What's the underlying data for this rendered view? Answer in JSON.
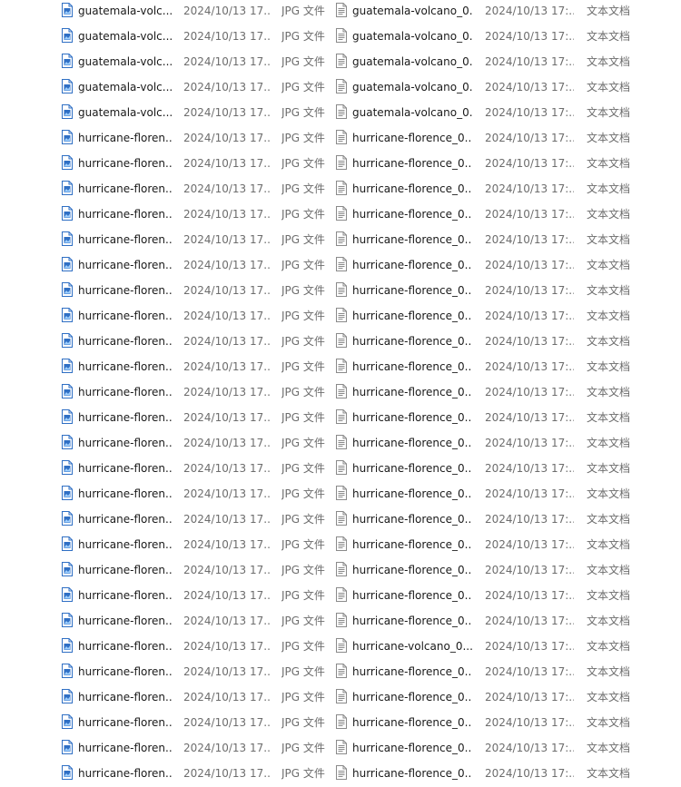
{
  "icons": {
    "image_file": "jpg-image-file-icon",
    "text_file": "text-document-icon"
  },
  "colors": {
    "jpg_icon_blue": "#2f6fc4",
    "text_icon_gray": "#8a8a8a",
    "meta_text": "#6d6d6d"
  },
  "rows": [
    {
      "left": {
        "name": "guatemala-volc...",
        "date": "2024/10/13 17...",
        "type": "JPG 文件"
      },
      "right": {
        "name": "guatemala-volcano_0...",
        "date": "2024/10/13 17:...",
        "type": "文本文档"
      }
    },
    {
      "left": {
        "name": "guatemala-volc...",
        "date": "2024/10/13 17...",
        "type": "JPG 文件"
      },
      "right": {
        "name": "guatemala-volcano_0...",
        "date": "2024/10/13 17:...",
        "type": "文本文档"
      }
    },
    {
      "left": {
        "name": "guatemala-volc...",
        "date": "2024/10/13 17...",
        "type": "JPG 文件"
      },
      "right": {
        "name": "guatemala-volcano_0...",
        "date": "2024/10/13 17:...",
        "type": "文本文档"
      }
    },
    {
      "left": {
        "name": "guatemala-volc...",
        "date": "2024/10/13 17...",
        "type": "JPG 文件"
      },
      "right": {
        "name": "guatemala-volcano_0...",
        "date": "2024/10/13 17:...",
        "type": "文本文档"
      }
    },
    {
      "left": {
        "name": "guatemala-volc...",
        "date": "2024/10/13 17...",
        "type": "JPG 文件"
      },
      "right": {
        "name": "guatemala-volcano_0...",
        "date": "2024/10/13 17:...",
        "type": "文本文档"
      }
    },
    {
      "left": {
        "name": "hurricane-floren...",
        "date": "2024/10/13 17...",
        "type": "JPG 文件"
      },
      "right": {
        "name": "hurricane-florence_0...",
        "date": "2024/10/13 17:...",
        "type": "文本文档"
      }
    },
    {
      "left": {
        "name": "hurricane-floren...",
        "date": "2024/10/13 17...",
        "type": "JPG 文件"
      },
      "right": {
        "name": "hurricane-florence_0...",
        "date": "2024/10/13 17:...",
        "type": "文本文档"
      }
    },
    {
      "left": {
        "name": "hurricane-floren...",
        "date": "2024/10/13 17...",
        "type": "JPG 文件"
      },
      "right": {
        "name": "hurricane-florence_0...",
        "date": "2024/10/13 17:...",
        "type": "文本文档"
      }
    },
    {
      "left": {
        "name": "hurricane-floren...",
        "date": "2024/10/13 17...",
        "type": "JPG 文件"
      },
      "right": {
        "name": "hurricane-florence_0...",
        "date": "2024/10/13 17:...",
        "type": "文本文档"
      }
    },
    {
      "left": {
        "name": "hurricane-floren...",
        "date": "2024/10/13 17...",
        "type": "JPG 文件"
      },
      "right": {
        "name": "hurricane-florence_0...",
        "date": "2024/10/13 17:...",
        "type": "文本文档"
      }
    },
    {
      "left": {
        "name": "hurricane-floren...",
        "date": "2024/10/13 17...",
        "type": "JPG 文件"
      },
      "right": {
        "name": "hurricane-florence_0...",
        "date": "2024/10/13 17:...",
        "type": "文本文档"
      }
    },
    {
      "left": {
        "name": "hurricane-floren...",
        "date": "2024/10/13 17...",
        "type": "JPG 文件"
      },
      "right": {
        "name": "hurricane-florence_0...",
        "date": "2024/10/13 17:...",
        "type": "文本文档"
      }
    },
    {
      "left": {
        "name": "hurricane-floren...",
        "date": "2024/10/13 17...",
        "type": "JPG 文件"
      },
      "right": {
        "name": "hurricane-florence_0...",
        "date": "2024/10/13 17:...",
        "type": "文本文档"
      }
    },
    {
      "left": {
        "name": "hurricane-floren...",
        "date": "2024/10/13 17...",
        "type": "JPG 文件"
      },
      "right": {
        "name": "hurricane-florence_0...",
        "date": "2024/10/13 17:...",
        "type": "文本文档"
      }
    },
    {
      "left": {
        "name": "hurricane-floren...",
        "date": "2024/10/13 17...",
        "type": "JPG 文件"
      },
      "right": {
        "name": "hurricane-florence_0...",
        "date": "2024/10/13 17:...",
        "type": "文本文档"
      }
    },
    {
      "left": {
        "name": "hurricane-floren...",
        "date": "2024/10/13 17...",
        "type": "JPG 文件"
      },
      "right": {
        "name": "hurricane-florence_0...",
        "date": "2024/10/13 17:...",
        "type": "文本文档"
      }
    },
    {
      "left": {
        "name": "hurricane-floren...",
        "date": "2024/10/13 17...",
        "type": "JPG 文件"
      },
      "right": {
        "name": "hurricane-florence_0...",
        "date": "2024/10/13 17:...",
        "type": "文本文档"
      }
    },
    {
      "left": {
        "name": "hurricane-floren...",
        "date": "2024/10/13 17...",
        "type": "JPG 文件"
      },
      "right": {
        "name": "hurricane-florence_0...",
        "date": "2024/10/13 17:...",
        "type": "文本文档"
      }
    },
    {
      "left": {
        "name": "hurricane-floren...",
        "date": "2024/10/13 17...",
        "type": "JPG 文件"
      },
      "right": {
        "name": "hurricane-florence_0...",
        "date": "2024/10/13 17:...",
        "type": "文本文档"
      }
    },
    {
      "left": {
        "name": "hurricane-floren...",
        "date": "2024/10/13 17...",
        "type": "JPG 文件"
      },
      "right": {
        "name": "hurricane-florence_0...",
        "date": "2024/10/13 17:...",
        "type": "文本文档"
      }
    },
    {
      "left": {
        "name": "hurricane-floren...",
        "date": "2024/10/13 17...",
        "type": "JPG 文件"
      },
      "right": {
        "name": "hurricane-florence_0...",
        "date": "2024/10/13 17:...",
        "type": "文本文档"
      }
    },
    {
      "left": {
        "name": "hurricane-floren...",
        "date": "2024/10/13 17...",
        "type": "JPG 文件"
      },
      "right": {
        "name": "hurricane-florence_0...",
        "date": "2024/10/13 17:...",
        "type": "文本文档"
      }
    },
    {
      "left": {
        "name": "hurricane-floren...",
        "date": "2024/10/13 17...",
        "type": "JPG 文件"
      },
      "right": {
        "name": "hurricane-florence_0...",
        "date": "2024/10/13 17:...",
        "type": "文本文档"
      }
    },
    {
      "left": {
        "name": "hurricane-floren...",
        "date": "2024/10/13 17...",
        "type": "JPG 文件"
      },
      "right": {
        "name": "hurricane-florence_0...",
        "date": "2024/10/13 17:...",
        "type": "文本文档"
      }
    },
    {
      "left": {
        "name": "hurricane-floren...",
        "date": "2024/10/13 17...",
        "type": "JPG 文件"
      },
      "right": {
        "name": "hurricane-florence_0...",
        "date": "2024/10/13 17:...",
        "type": "文本文档"
      }
    },
    {
      "left": {
        "name": "hurricane-floren...",
        "date": "2024/10/13 17...",
        "type": "JPG 文件"
      },
      "right": {
        "name": "hurricane-volcano_0...",
        "date": "2024/10/13 17:...",
        "type": "文本文档"
      }
    },
    {
      "left": {
        "name": "hurricane-floren...",
        "date": "2024/10/13 17...",
        "type": "JPG 文件"
      },
      "right": {
        "name": "hurricane-florence_0...",
        "date": "2024/10/13 17:...",
        "type": "文本文档"
      }
    },
    {
      "left": {
        "name": "hurricane-floren...",
        "date": "2024/10/13 17...",
        "type": "JPG 文件"
      },
      "right": {
        "name": "hurricane-florence_0...",
        "date": "2024/10/13 17:...",
        "type": "文本文档"
      }
    },
    {
      "left": {
        "name": "hurricane-floren...",
        "date": "2024/10/13 17...",
        "type": "JPG 文件"
      },
      "right": {
        "name": "hurricane-florence_0...",
        "date": "2024/10/13 17:...",
        "type": "文本文档"
      }
    },
    {
      "left": {
        "name": "hurricane-floren...",
        "date": "2024/10/13 17...",
        "type": "JPG 文件"
      },
      "right": {
        "name": "hurricane-florence_0...",
        "date": "2024/10/13 17:...",
        "type": "文本文档"
      }
    },
    {
      "left": {
        "name": "hurricane-floren...",
        "date": "2024/10/13 17...",
        "type": "JPG 文件"
      },
      "right": {
        "name": "hurricane-florence_0...",
        "date": "2024/10/13 17:...",
        "type": "文本文档"
      }
    }
  ]
}
